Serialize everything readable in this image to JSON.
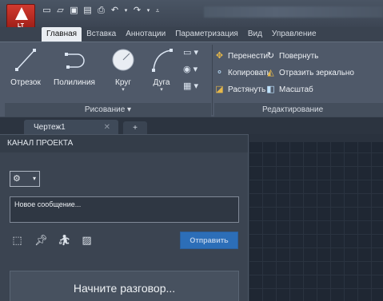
{
  "app": {
    "logo_sub": "LT",
    "quick_access": [
      "new-icon",
      "open-icon",
      "save-icon",
      "saveas-icon",
      "print-icon",
      "undo-icon",
      "redo-icon",
      "customize-icon"
    ]
  },
  "ribbon": {
    "tabs": [
      "Главная",
      "Вставка",
      "Аннотации",
      "Параметризация",
      "Вид",
      "Управление"
    ],
    "draw_panel": {
      "tools": [
        "Отрезок",
        "Полилиния",
        "Круг",
        "Дуга"
      ],
      "label": "Рисование ▾"
    },
    "edit_panel": {
      "items": [
        "Перенести",
        "Копировать",
        "Растянуть",
        "Повернуть",
        "Отразить зеркально",
        "Масштаб"
      ],
      "label": "Редактирование"
    }
  },
  "document": {
    "tab": "Чертеж1",
    "close": "✕",
    "new_tab": "+"
  },
  "palette": {
    "title": "КАНАЛ ПРОЕКТА",
    "gear": "⚙",
    "gear_dd": "▾",
    "message_placeholder": "Новое сообщение...",
    "send_label": "Отправить",
    "start_text": "Начните разговор..."
  },
  "colors": {
    "app_button": "#c2302a",
    "send_button": "#2c6eb8",
    "canvas": "#1f2733"
  }
}
